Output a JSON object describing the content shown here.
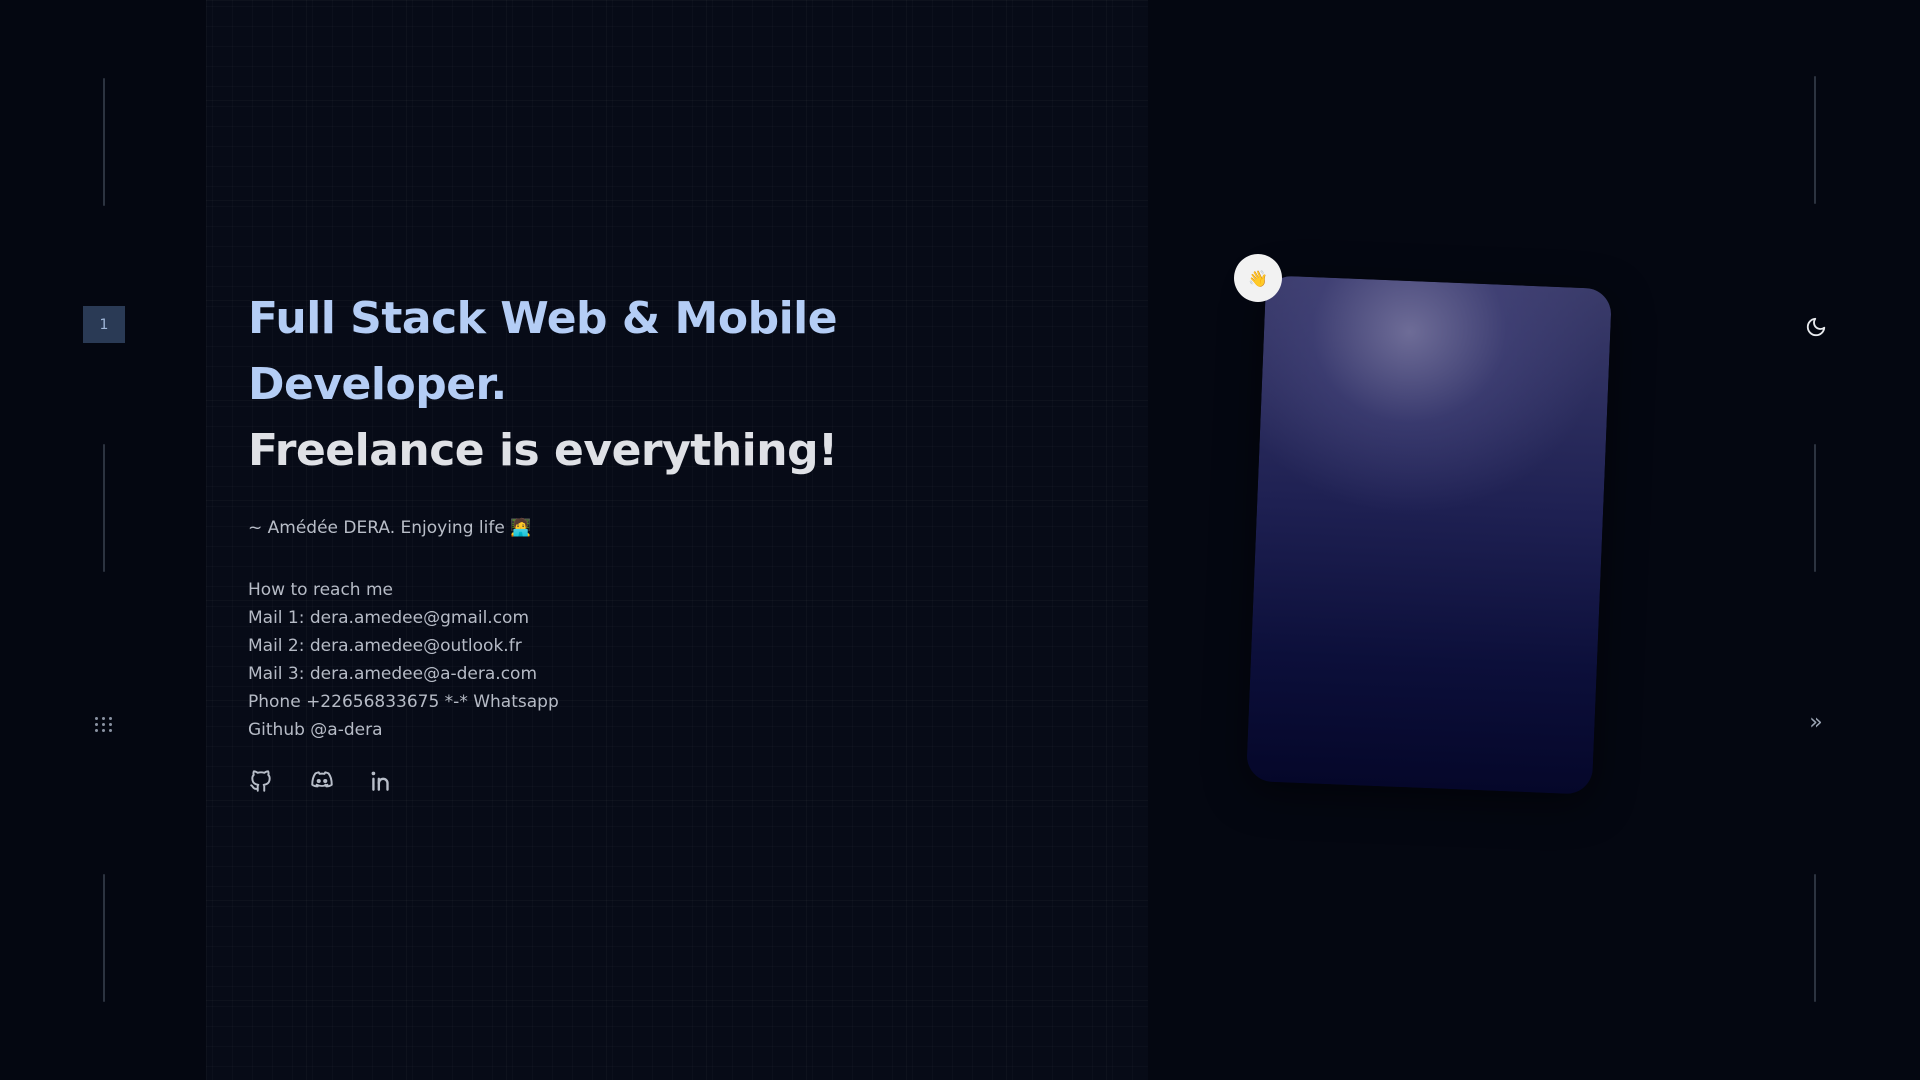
{
  "pager": {
    "current_page": "1"
  },
  "hero": {
    "line1": "Full Stack Web & Mobile",
    "line2": "Developer.",
    "line3": "Freelance is everything!",
    "tagline": "~ Amédée DERA. Enjoying life 🧑‍💻"
  },
  "contact": {
    "heading": "How to reach me",
    "mail1": "Mail 1: dera.amedee@gmail.com",
    "mail2": "Mail 2: dera.amedee@outlook.fr",
    "mail3": "Mail 3: dera.amedee@a-dera.com",
    "phone": "Phone +22656833675 *-* Whatsapp",
    "github": "Github @a-dera"
  },
  "socials": [
    {
      "icon": "github-icon"
    },
    {
      "icon": "discord-icon"
    },
    {
      "icon": "linkedin-icon"
    }
  ],
  "badge": {
    "emoji": "👋"
  },
  "nav": {
    "next_symbol": "»"
  },
  "colors": {
    "background": "#040711",
    "accent_text": "#b4cdf5",
    "headline_text": "#dfe1e6",
    "page_indicator_bg": "#2a3a55"
  }
}
